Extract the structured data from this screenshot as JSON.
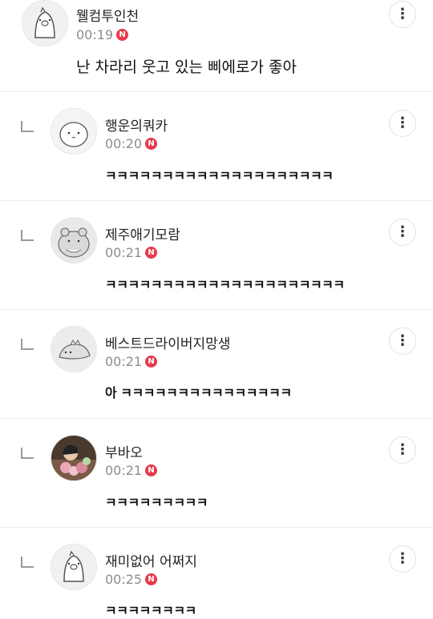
{
  "comments": [
    {
      "nickname": "웰컴투인천",
      "time": "00:19",
      "new_badge": "N",
      "text": "난 차라리 웃고 있는 삐에로가 좋아",
      "is_reply": false,
      "avatar_icon": "pig-avatar-icon"
    },
    {
      "nickname": "행운의쿼카",
      "time": "00:20",
      "new_badge": "N",
      "text": "ㅋㅋㅋㅋㅋㅋㅋㅋㅋㅋㅋㅋㅋㅋㅋㅋㅋㅋㅋㅋ",
      "is_reply": true,
      "avatar_icon": "quokka-avatar-icon"
    },
    {
      "nickname": "제주애기모람",
      "time": "00:21",
      "new_badge": "N",
      "text": "ㅋㅋㅋㅋㅋㅋㅋㅋㅋㅋㅋㅋㅋㅋㅋㅋㅋㅋㅋㅋㅋ",
      "is_reply": true,
      "avatar_icon": "hamster-avatar-icon"
    },
    {
      "nickname": "베스트드라이버지망생",
      "time": "00:21",
      "new_badge": "N",
      "text": "아 ㅋㅋㅋㅋㅋㅋㅋㅋㅋㅋㅋㅋㅋㅋㅋ",
      "is_reply": true,
      "avatar_icon": "dinosaur-avatar-icon"
    },
    {
      "nickname": "부바오",
      "time": "00:21",
      "new_badge": "N",
      "text": "ㅋㅋㅋㅋㅋㅋㅋㅋㅋ",
      "is_reply": true,
      "avatar_icon": "photo-avatar-icon"
    },
    {
      "nickname": "재미없어 어쩌지",
      "time": "00:25",
      "new_badge": "N",
      "text": "ㅋㅋㅋㅋㅋㅋㅋㅋ",
      "is_reply": true,
      "avatar_icon": "pig-avatar-icon"
    }
  ],
  "more_icon": "more-vertical-icon",
  "more_glyph": "⋮"
}
